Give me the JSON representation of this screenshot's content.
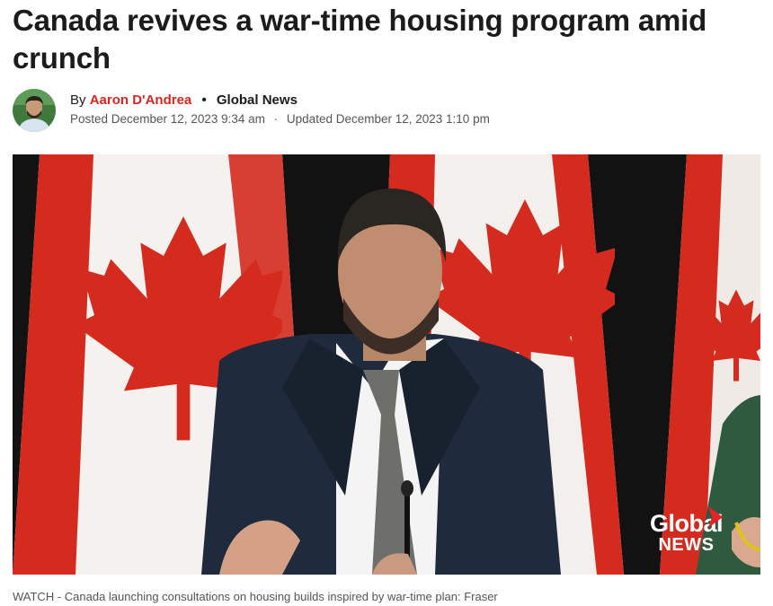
{
  "article": {
    "headline": "Canada revives a war-time housing program amid crunch"
  },
  "byline": {
    "by_prefix": "By",
    "author": "Aaron D'Andrea",
    "separator": "•",
    "outlet": "Global News",
    "posted_label": "Posted December 12, 2023 9:34 am",
    "divider": "·",
    "updated_label": "Updated December 12, 2023 1:10 pm"
  },
  "media": {
    "logo_line1": "Global",
    "logo_line2": "NEWS",
    "caption": "WATCH - Canada launching consultations on housing builds inspired by war-time plan: Fraser"
  },
  "colors": {
    "author_link": "#d7261e",
    "flag_red": "#d52b1e",
    "logo_red": "#e8202a"
  }
}
